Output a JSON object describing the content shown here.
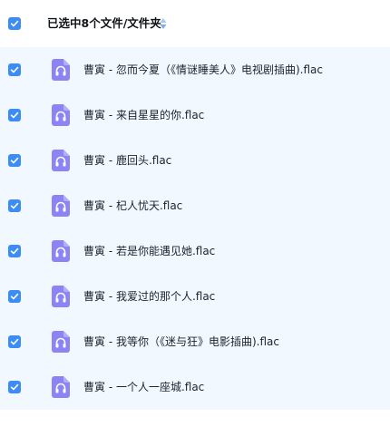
{
  "header": {
    "title": "已选中8个文件/文件夹",
    "all_checked": true
  },
  "colors": {
    "checkbox": "#3b8cf5",
    "list_background": "#f2f8ff",
    "file_icon": "#8c83f5"
  },
  "files": [
    {
      "name": "曹寅 - 忽而今夏（《情谜睡美人》电视剧插曲).flac",
      "checked": true,
      "icon": "audio-file-icon"
    },
    {
      "name": "曹寅 - 来自星星的你.flac",
      "checked": true,
      "icon": "audio-file-icon"
    },
    {
      "name": "曹寅 - 鹿回头.flac",
      "checked": true,
      "icon": "audio-file-icon"
    },
    {
      "name": "曹寅 - 杞人忧天.flac",
      "checked": true,
      "icon": "audio-file-icon"
    },
    {
      "name": "曹寅 - 若是你能遇见她.flac",
      "checked": true,
      "icon": "audio-file-icon"
    },
    {
      "name": "曹寅 - 我爱过的那个人.flac",
      "checked": true,
      "icon": "audio-file-icon"
    },
    {
      "name": "曹寅 - 我等你（《迷与狂》电影插曲).flac",
      "checked": true,
      "icon": "audio-file-icon"
    },
    {
      "name": "曹寅 - 一个人一座城.flac",
      "checked": true,
      "icon": "audio-file-icon"
    }
  ]
}
